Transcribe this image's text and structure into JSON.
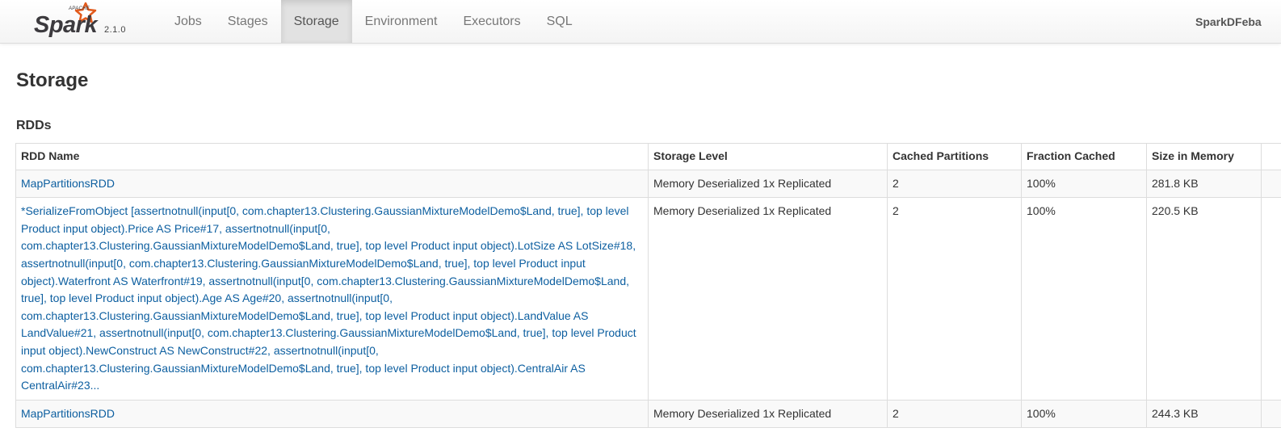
{
  "navbar": {
    "logo_text": "Spark",
    "logo_superscript": "APACHE",
    "version": "2.1.0",
    "tabs": [
      {
        "label": "Jobs"
      },
      {
        "label": "Stages"
      },
      {
        "label": "Storage",
        "active": true
      },
      {
        "label": "Environment"
      },
      {
        "label": "Executors"
      },
      {
        "label": "SQL"
      }
    ],
    "app_name": "SparkDFeba"
  },
  "page": {
    "title": "Storage",
    "section_title": "RDDs"
  },
  "table": {
    "columns": [
      "RDD Name",
      "Storage Level",
      "Cached Partitions",
      "Fraction Cached",
      "Size in Memory",
      ""
    ],
    "rows": [
      {
        "name": "MapPartitionsRDD",
        "storage_level": "Memory Deserialized 1x Replicated",
        "cached_partitions": "2",
        "fraction_cached": "100%",
        "size_in_memory": "281.8 KB"
      },
      {
        "name": "*SerializeFromObject [assertnotnull(input[0, com.chapter13.Clustering.GaussianMixtureModelDemo$Land, true], top level Product input object).Price AS Price#17, assertnotnull(input[0, com.chapter13.Clustering.GaussianMixtureModelDemo$Land, true], top level Product input object).LotSize AS LotSize#18, assertnotnull(input[0, com.chapter13.Clustering.GaussianMixtureModelDemo$Land, true], top level Product input object).Waterfront AS Waterfront#19, assertnotnull(input[0, com.chapter13.Clustering.GaussianMixtureModelDemo$Land, true], top level Product input object).Age AS Age#20, assertnotnull(input[0, com.chapter13.Clustering.GaussianMixtureModelDemo$Land, true], top level Product input object).LandValue AS LandValue#21, assertnotnull(input[0, com.chapter13.Clustering.GaussianMixtureModelDemo$Land, true], top level Product input object).NewConstruct AS NewConstruct#22, assertnotnull(input[0, com.chapter13.Clustering.GaussianMixtureModelDemo$Land, true], top level Product input object).CentralAir AS CentralAir#23...",
        "storage_level": "Memory Deserialized 1x Replicated",
        "cached_partitions": "2",
        "fraction_cached": "100%",
        "size_in_memory": "220.5 KB"
      },
      {
        "name": "MapPartitionsRDD",
        "storage_level": "Memory Deserialized 1x Replicated",
        "cached_partitions": "2",
        "fraction_cached": "100%",
        "size_in_memory": "244.3 KB"
      }
    ]
  },
  "colors": {
    "link": "#0d5fa0",
    "logo_orange": "#e25a1c",
    "logo_text": "#3c3a3e",
    "active_tab_bg": "#e2e2e2"
  }
}
